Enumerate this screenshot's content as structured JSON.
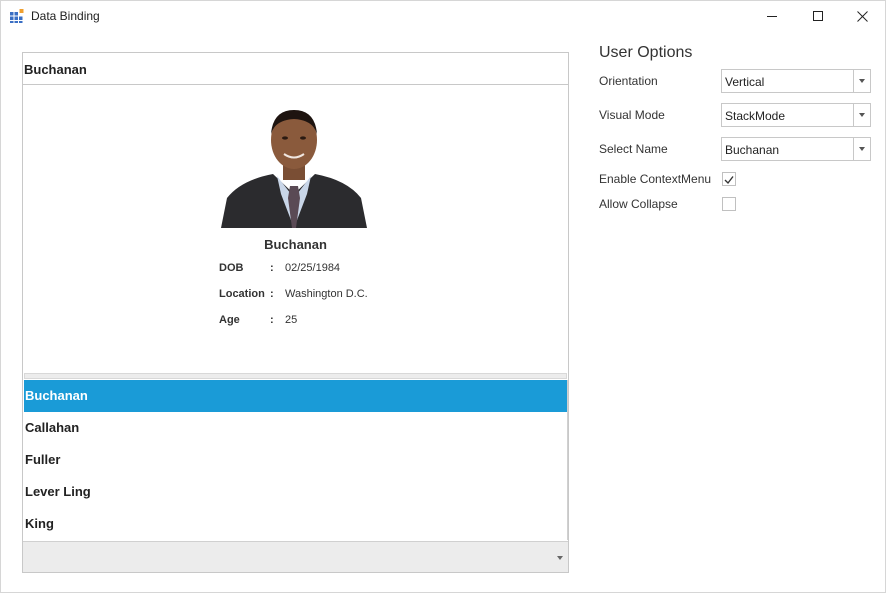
{
  "window": {
    "title": "Data Binding",
    "icon": "grid-app-icon",
    "controls": [
      "minimize-icon",
      "maximize-icon",
      "close-icon"
    ]
  },
  "tile": {
    "header": "Buchanan",
    "person": {
      "name": "Buchanan",
      "photo": "employee-photo",
      "details": [
        {
          "label": "DOB",
          "sep": ":",
          "value": "02/25/1984"
        },
        {
          "label": "Location",
          "sep": ":",
          "value": "Washington D.C."
        },
        {
          "label": "Age",
          "sep": ":",
          "value": "25"
        }
      ]
    },
    "list": [
      {
        "name": "Buchanan",
        "selected": true
      },
      {
        "name": "Callahan",
        "selected": false
      },
      {
        "name": "Fuller",
        "selected": false
      },
      {
        "name": "Lever Ling",
        "selected": false
      },
      {
        "name": "King",
        "selected": false
      }
    ]
  },
  "options": {
    "title": "User Options",
    "orientation": {
      "label": "Orientation",
      "value": "Vertical"
    },
    "visual_mode": {
      "label": "Visual Mode",
      "value": "StackMode"
    },
    "select_name": {
      "label": "Select Name",
      "value": "Buchanan"
    },
    "enable_context_menu": {
      "label": "Enable ContextMenu",
      "checked": true
    },
    "allow_collapse": {
      "label": "Allow Collapse",
      "checked": false
    }
  },
  "colors": {
    "selection": "#1a9bd7",
    "border": "#c8c8c8",
    "footer": "#ececec"
  }
}
